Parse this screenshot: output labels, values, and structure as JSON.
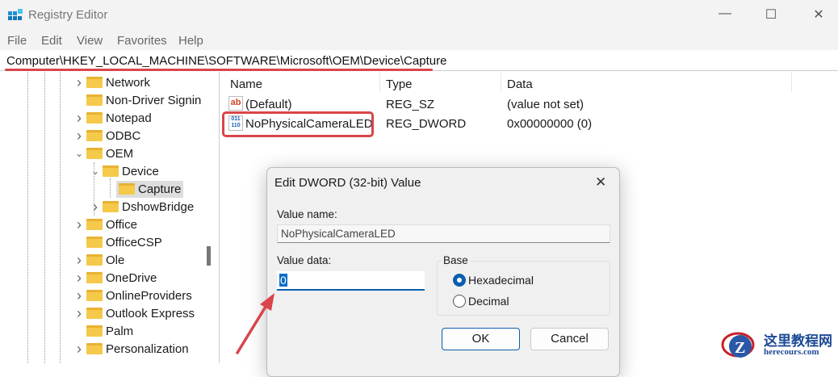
{
  "window": {
    "title": "Registry Editor",
    "minimize": "—",
    "maximize": "☐",
    "close": "✕"
  },
  "menu": [
    "File",
    "Edit",
    "View",
    "Favorites",
    "Help"
  ],
  "address": "Computer\\HKEY_LOCAL_MACHINE\\SOFTWARE\\Microsoft\\OEM\\Device\\Capture",
  "tree": [
    {
      "label": "Network",
      "depth": 1,
      "exp": "closed"
    },
    {
      "label": "Non-Driver Signin",
      "depth": 1,
      "exp": "none"
    },
    {
      "label": "Notepad",
      "depth": 1,
      "exp": "closed"
    },
    {
      "label": "ODBC",
      "depth": 1,
      "exp": "closed"
    },
    {
      "label": "OEM",
      "depth": 1,
      "exp": "open"
    },
    {
      "label": "Device",
      "depth": 2,
      "exp": "open"
    },
    {
      "label": "Capture",
      "depth": 3,
      "exp": "none",
      "selected": true
    },
    {
      "label": "DshowBridge",
      "depth": 2,
      "exp": "closed"
    },
    {
      "label": "Office",
      "depth": 1,
      "exp": "closed"
    },
    {
      "label": "OfficeCSP",
      "depth": 1,
      "exp": "none"
    },
    {
      "label": "Ole",
      "depth": 1,
      "exp": "closed"
    },
    {
      "label": "OneDrive",
      "depth": 1,
      "exp": "closed"
    },
    {
      "label": "OnlineProviders",
      "depth": 1,
      "exp": "closed"
    },
    {
      "label": "Outlook Express",
      "depth": 1,
      "exp": "closed"
    },
    {
      "label": "Palm",
      "depth": 1,
      "exp": "none"
    },
    {
      "label": "Personalization",
      "depth": 1,
      "exp": "closed"
    }
  ],
  "list": {
    "columns": [
      "Name",
      "Type",
      "Data"
    ],
    "rows": [
      {
        "icon": "ab",
        "name": "(Default)",
        "type": "REG_SZ",
        "data": "(value not set)"
      },
      {
        "icon": "011\n110",
        "name": "NoPhysicalCameraLED",
        "type": "REG_DWORD",
        "data": "0x00000000 (0)"
      }
    ]
  },
  "dialog": {
    "title": "Edit DWORD (32-bit) Value",
    "close": "✕",
    "value_name_label": "Value name:",
    "value_name": "NoPhysicalCameraLED",
    "value_data_label": "Value data:",
    "value_data": "0",
    "base_label": "Base",
    "hex_label": "Hexadecimal",
    "dec_label": "Decimal",
    "base_selected": "Hexadecimal",
    "ok": "OK",
    "cancel": "Cancel"
  },
  "watermark": {
    "title": "这里教程网",
    "site": "herecours.com"
  },
  "colors": {
    "annotation": "#d9454b",
    "accent": "#0b5fad"
  }
}
